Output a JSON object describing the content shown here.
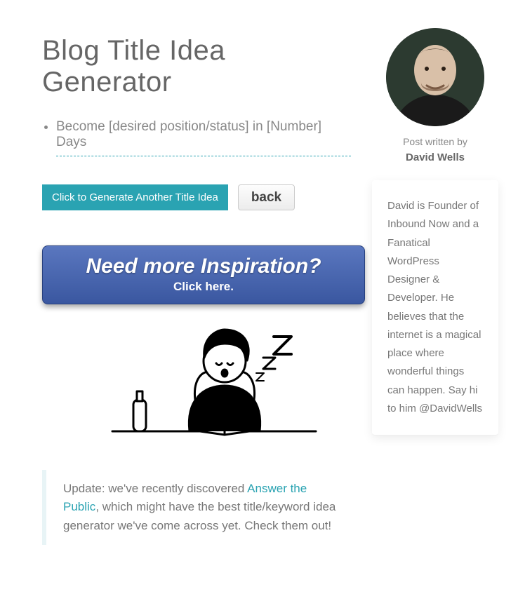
{
  "page": {
    "title": "Blog Title Idea Generator"
  },
  "idea": {
    "text": "Become [desired position/status] in [Number] Days"
  },
  "buttons": {
    "generate": "Click to Generate Another Title Idea",
    "back": "back"
  },
  "inspiration": {
    "line1": "Need more Inspiration?",
    "line2": "Click here."
  },
  "note": {
    "before": "Update: we've recently discovered ",
    "link_text": "Answer the Public",
    "after": ", which might have the best title/keyword idea generator we've come across yet. Check them out!"
  },
  "author": {
    "byline_label": "Post written by",
    "name": "David Wells",
    "bio": "David is Founder of Inbound Now and a Fanatical WordPress Designer & Developer. He believes that the internet is a magical place where wonderful things can happen. Say hi to him @DavidWells"
  }
}
